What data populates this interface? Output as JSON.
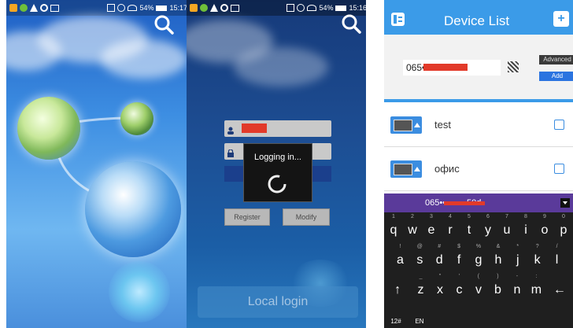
{
  "status_bar_left": {
    "battery": "54%",
    "time": "15:17"
  },
  "status_bar_mid": {
    "battery": "54%",
    "time": "15:16"
  },
  "login": {
    "username_placeholder": "",
    "logging_in_text": "Logging in...",
    "register_label": "Register",
    "modify_label": "Modify",
    "local_login_label": "Local login"
  },
  "device_list": {
    "title": "Device List",
    "serial_value": "065••••••••50d",
    "advanced_label": "Advanced",
    "add_label": "Add",
    "devices": [
      {
        "name": "test"
      },
      {
        "name": "офис"
      }
    ],
    "keyboard_input": "065•••••••••50d"
  },
  "keyboard": {
    "row1": [
      {
        "k": "q",
        "a": "1"
      },
      {
        "k": "w",
        "a": "2"
      },
      {
        "k": "e",
        "a": "3"
      },
      {
        "k": "r",
        "a": "4"
      },
      {
        "k": "t",
        "a": "5"
      },
      {
        "k": "y",
        "a": "6"
      },
      {
        "k": "u",
        "a": "7"
      },
      {
        "k": "i",
        "a": "8"
      },
      {
        "k": "o",
        "a": "9"
      },
      {
        "k": "p",
        "a": "0"
      }
    ],
    "row2": [
      {
        "k": "a",
        "a": "!"
      },
      {
        "k": "s",
        "a": "@"
      },
      {
        "k": "d",
        "a": "#"
      },
      {
        "k": "f",
        "a": "$"
      },
      {
        "k": "g",
        "a": "%"
      },
      {
        "k": "h",
        "a": "&"
      },
      {
        "k": "j",
        "a": "*"
      },
      {
        "k": "k",
        "a": "?"
      },
      {
        "k": "l",
        "a": "/"
      }
    ],
    "row3": [
      {
        "k": "z",
        "a": "_"
      },
      {
        "k": "x",
        "a": "\""
      },
      {
        "k": "c",
        "a": "'"
      },
      {
        "k": "v",
        "a": "("
      },
      {
        "k": "b",
        "a": ")"
      },
      {
        "k": "n",
        "a": "-"
      },
      {
        "k": "m",
        "a": ":"
      }
    ],
    "shift_label": "↑",
    "backspace_label": "←",
    "sym_label": "12#",
    "lang_label": "EN"
  },
  "colors": {
    "header_blue": "#3b9be8",
    "accent_red": "#e23a2a",
    "keyboard_bg": "#1f1f1f",
    "input_purple": "#5a3a9a"
  }
}
